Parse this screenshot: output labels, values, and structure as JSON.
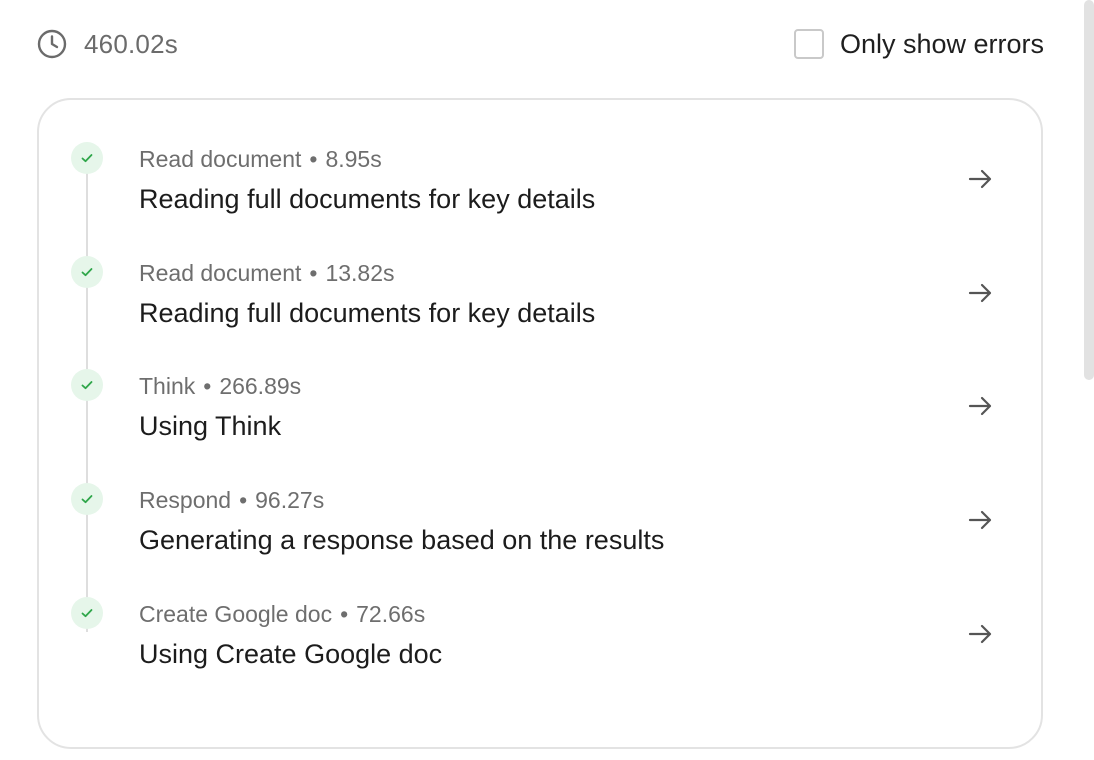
{
  "header": {
    "total_time": "460.02s",
    "clock_icon": "clock-icon",
    "filter_label": "Only show errors",
    "filter_checked": false
  },
  "steps": [
    {
      "tool": "Read document",
      "duration": "8.95s",
      "title": "Reading full documents for key details",
      "status": "success"
    },
    {
      "tool": "Read document",
      "duration": "13.82s",
      "title": "Reading full documents for key details",
      "status": "success"
    },
    {
      "tool": "Think",
      "duration": "266.89s",
      "title": "Using Think",
      "status": "success"
    },
    {
      "tool": "Respond",
      "duration": "96.27s",
      "title": "Generating a response based on the results",
      "status": "success"
    },
    {
      "tool": "Create Google doc",
      "duration": "72.66s",
      "title": "Using Create Google doc",
      "status": "success"
    }
  ],
  "icons": {
    "status": "check-icon",
    "open": "arrow-right-icon"
  },
  "colors": {
    "success": "#2fa64a",
    "success_bg": "#e6f6ea",
    "muted_text": "#6e6e6e",
    "border": "#e3e3e3"
  },
  "separator": "•"
}
